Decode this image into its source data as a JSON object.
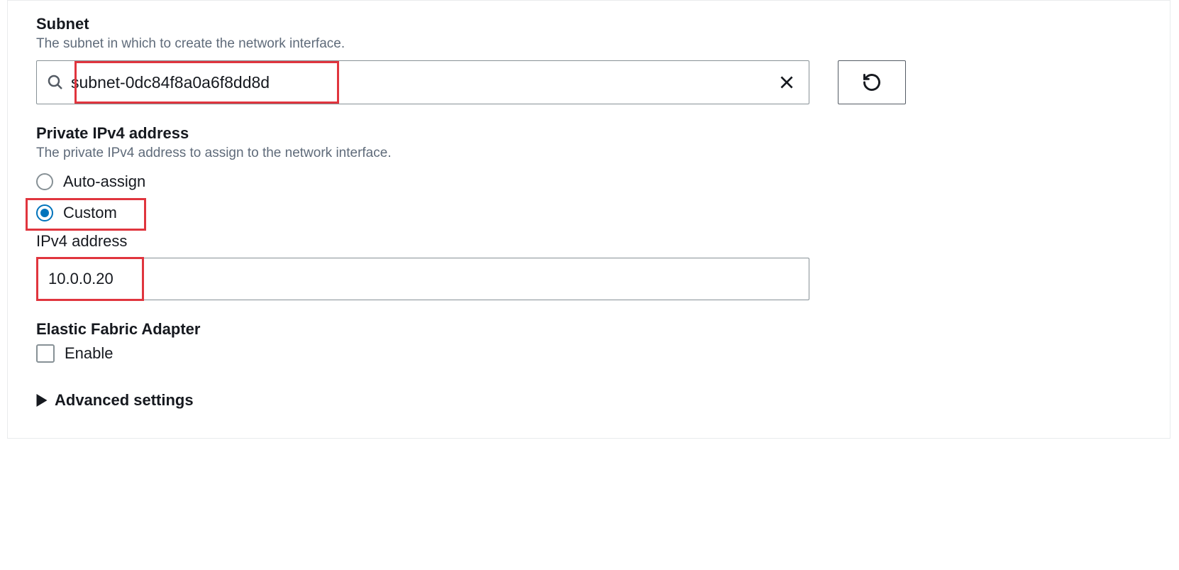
{
  "subnet": {
    "label": "Subnet",
    "help": "The subnet in which to create the network interface.",
    "value": "subnet-0dc84f8a0a6f8dd8d"
  },
  "private_ip": {
    "label": "Private IPv4 address",
    "help": "The private IPv4 address to assign to the network interface.",
    "option_auto": "Auto-assign",
    "option_custom": "Custom",
    "selected": "custom",
    "ipv4_label": "IPv4 address",
    "ipv4_value": "10.0.0.20"
  },
  "efa": {
    "label": "Elastic Fabric Adapter",
    "enable_label": "Enable",
    "enabled": false
  },
  "advanced": {
    "label": "Advanced settings"
  }
}
